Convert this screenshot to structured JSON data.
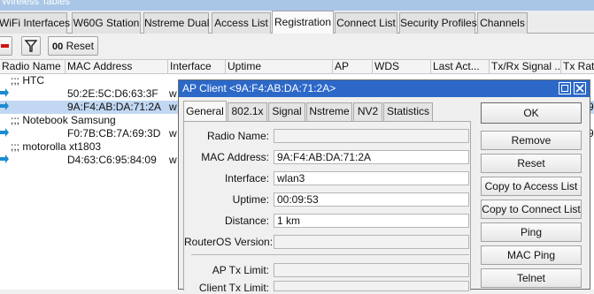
{
  "window": {
    "title": "Wireless Tables"
  },
  "tabs": [
    {
      "label": "WiFi Interfaces"
    },
    {
      "label": "W60G Station"
    },
    {
      "label": "Nstreme Dual"
    },
    {
      "label": "Access List"
    },
    {
      "label": "Registration"
    },
    {
      "label": "Connect List"
    },
    {
      "label": "Security Profiles"
    },
    {
      "label": "Channels"
    }
  ],
  "toolbar": {
    "reset_label": "Reset",
    "reset_prefix": "00"
  },
  "columns": [
    "Radio Name",
    "MAC Address",
    "Interface",
    "Uptime",
    "AP",
    "WDS",
    "Last Act...",
    "Tx/Rx Signal ...",
    "Tx Rate"
  ],
  "rows": [
    {
      "comment": ";;; HTC"
    },
    {
      "mac": "50:2E:5C:D6:63:3F",
      "iface": "w"
    },
    {
      "mac": "9A:F4:AB:DA:71:2A",
      "iface": "w"
    },
    {
      "comment": ";;; Notebook Samsung"
    },
    {
      "mac": "F0:7B:CB:7A:69:3D",
      "iface": "w"
    },
    {
      "comment": ";;; motorolla xt1803"
    },
    {
      "mac": "D4:63:C6:95:84:09",
      "iface": "w"
    }
  ],
  "right_edge": [
    "9",
    "9"
  ],
  "dialog": {
    "title": "AP Client <9A:F4:AB:DA:71:2A>",
    "tabs": [
      "General",
      "802.1x",
      "Signal",
      "Nstreme",
      "NV2",
      "Statistics"
    ],
    "fields": {
      "radio_name_label": "Radio Name:",
      "radio_name": "",
      "mac_label": "MAC Address:",
      "mac": "9A:F4:AB:DA:71:2A",
      "interface_label": "Interface:",
      "interface": "wlan3",
      "uptime_label": "Uptime:",
      "uptime": "00:09:53",
      "distance_label": "Distance:",
      "distance": "1 km",
      "routeros_label": "RouterOS Version:",
      "routeros": "",
      "ap_tx_label": "AP Tx Limit:",
      "ap_tx": "",
      "client_tx_label": "Client Tx Limit:",
      "client_tx": ""
    },
    "buttons": [
      "OK",
      "Remove",
      "Reset",
      "Copy to Access List",
      "Copy to Connect List",
      "Ping",
      "MAC Ping",
      "Telnet"
    ]
  }
}
